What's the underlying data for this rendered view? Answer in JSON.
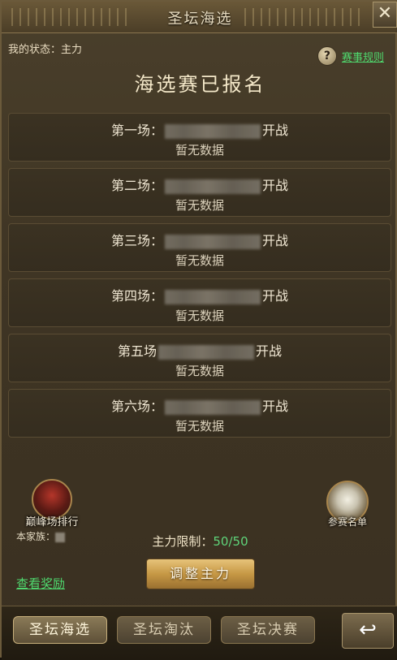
{
  "header": {
    "title": "圣坛海选",
    "close_icon": "✕"
  },
  "status": {
    "text": "我的状态：主力"
  },
  "rules": {
    "icon": "?",
    "label": "赛事规则"
  },
  "headline": "海选赛已报名",
  "rounds": [
    {
      "prefix": "第一场：",
      "suffix": "开战",
      "data": "暂无数据"
    },
    {
      "prefix": "第二场：",
      "suffix": "开战",
      "data": "暂无数据"
    },
    {
      "prefix": "第三场：",
      "suffix": "开战",
      "data": "暂无数据"
    },
    {
      "prefix": "第四场：",
      "suffix": "开战",
      "data": "暂无数据"
    },
    {
      "prefix": "第五场",
      "suffix": "开战",
      "data": "暂无数据"
    },
    {
      "prefix": "第六场：",
      "suffix": "开战",
      "data": "暂无数据"
    }
  ],
  "peak_ranking": {
    "label": "巅峰场排行"
  },
  "clan": {
    "label": "本家族："
  },
  "roster": {
    "label": "参赛名单"
  },
  "limit": {
    "label": "主力限制：",
    "value": "50/50"
  },
  "reward_link": "查看奖励",
  "adjust_button": "调整主力",
  "tabs": [
    {
      "label": "圣坛海选",
      "active": true
    },
    {
      "label": "圣坛淘汰",
      "active": false
    },
    {
      "label": "圣坛决赛",
      "active": false
    }
  ],
  "back_icon": "↩",
  "colors": {
    "link_green": "#4fd86e",
    "value_green": "#5fd47a",
    "gold_button": "#c69845"
  }
}
